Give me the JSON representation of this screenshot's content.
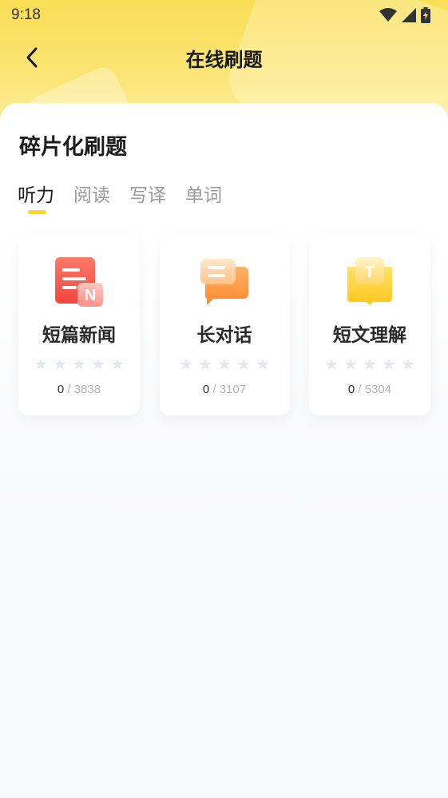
{
  "status_bar": {
    "time": "9:18"
  },
  "nav": {
    "title": "在线刷题"
  },
  "section": {
    "title": "碎片化刷题"
  },
  "tabs": [
    {
      "label": "听力",
      "active": true
    },
    {
      "label": "阅读",
      "active": false
    },
    {
      "label": "写译",
      "active": false
    },
    {
      "label": "单词",
      "active": false
    }
  ],
  "cards": [
    {
      "title": "短篇新闻",
      "done": "0",
      "separator": "/",
      "total": "3838",
      "icon": "news-icon",
      "stars": 5
    },
    {
      "title": "长对话",
      "done": "0",
      "separator": "/",
      "total": "3107",
      "icon": "dialogue-icon",
      "stars": 5
    },
    {
      "title": "短文理解",
      "done": "0",
      "separator": "/",
      "total": "5304",
      "icon": "reading-icon",
      "stars": 5
    }
  ],
  "colors": {
    "header_yellow": "#f9de55",
    "tab_indicator": "#ffd81a",
    "star_empty": "#e3e6ea"
  }
}
